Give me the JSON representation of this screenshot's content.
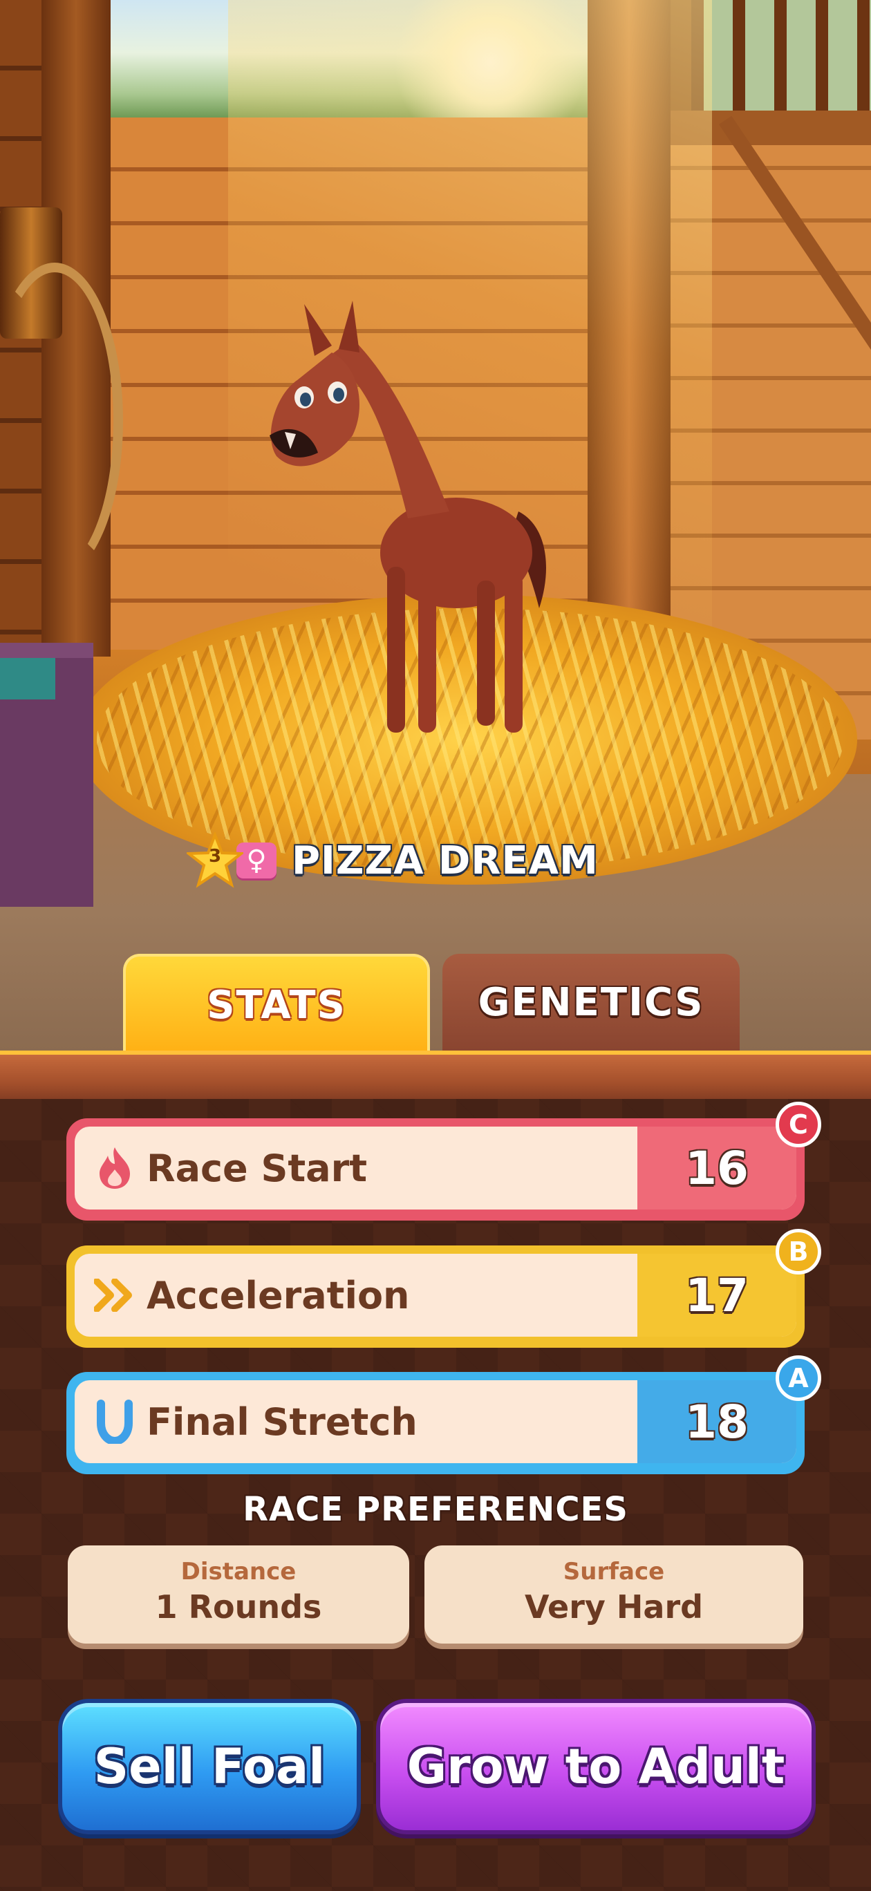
{
  "horse": {
    "level": "3",
    "gender_symbol": "♀",
    "name": "PIZZA DREAM"
  },
  "tabs": {
    "stats_label": "STATS",
    "genetics_label": "GENETICS",
    "active": "stats"
  },
  "stats": [
    {
      "label": "Race Start",
      "value": "16",
      "grade": "C",
      "color": "#e8566a",
      "icon": "flame-icon"
    },
    {
      "label": "Acceleration",
      "value": "17",
      "grade": "B",
      "color": "#f2c12c",
      "icon": "double-chevron-icon"
    },
    {
      "label": "Final Stretch",
      "value": "18",
      "grade": "A",
      "color": "#3fb5ef",
      "icon": "horseshoe-icon"
    }
  ],
  "race_preferences": {
    "title": "RACE PREFERENCES",
    "distance": {
      "label": "Distance",
      "value": "1 Rounds"
    },
    "surface": {
      "label": "Surface",
      "value": "Very Hard"
    }
  },
  "actions": {
    "sell_label": "Sell Foal",
    "grow_label": "Grow to Adult"
  }
}
